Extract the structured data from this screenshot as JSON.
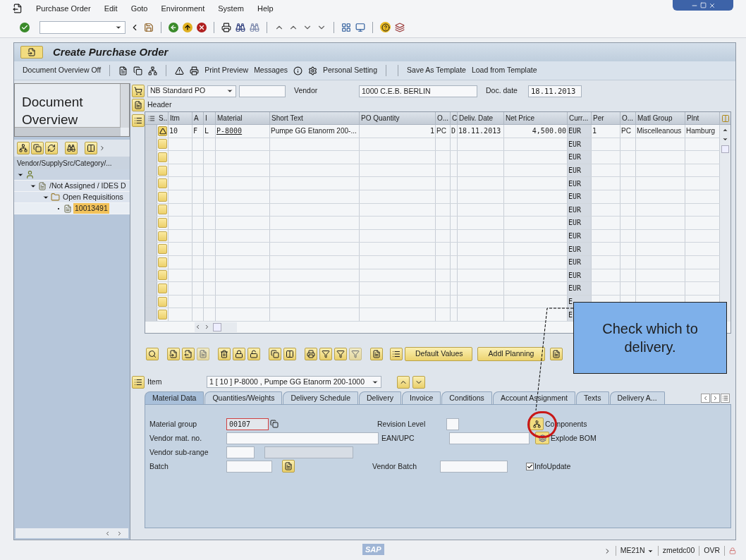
{
  "menu": [
    {
      "label": "Purchase Order"
    },
    {
      "label": "Edit"
    },
    {
      "label": "Goto"
    },
    {
      "label": "Environment"
    },
    {
      "label": "System"
    },
    {
      "label": "Help"
    }
  ],
  "title": "Create Purchase Order",
  "app_toolbar": [
    {
      "label": "Document Overview Off"
    },
    {
      "label": "Print Preview"
    },
    {
      "label": "Messages"
    },
    {
      "label": "Personal Setting"
    },
    {
      "label": "Save As Template"
    },
    {
      "label": "Load from Template"
    }
  ],
  "left_panel": {
    "overview_title": "Document Overview",
    "column_header": "Vendor/SupplySrc/Category/...",
    "tree": [
      {
        "kind": "vendor",
        "expanded": true,
        "selected": false,
        "children": [
          {
            "kind": "document",
            "label": "/Not Assigned / IDES D",
            "expanded": true,
            "selected": false,
            "children": [
              {
                "kind": "folder",
                "label": "Open Requisitions",
                "expanded": true,
                "selected": false,
                "children": [
                  {
                    "kind": "document",
                    "label": "10013491",
                    "selected": true
                  }
                ]
              }
            ]
          }
        ]
      }
    ]
  },
  "header_bar": {
    "doc_type": "NB Standard PO",
    "vendor_label": "Vendor",
    "vendor": "1000 C.E.B. BERLIN",
    "doc_date_label": "Doc. date",
    "doc_date": "18.11.2013",
    "header_label": "Header"
  },
  "items_table": {
    "columns": [
      "S..",
      "Itm",
      "A",
      "I",
      "Material",
      "Short Text",
      "PO Quantity",
      "O...",
      "C",
      "Deliv. Date",
      "Net Price",
      "Curr...",
      "Per",
      "O...",
      "Matl Group",
      "Plnt"
    ],
    "rows": [
      {
        "warning": true,
        "item": "10",
        "a": "F",
        "i": "L",
        "material": "P-8000",
        "short_text": "Pumpe GG Etanorm 200-...",
        "quantity": "1",
        "unit": "PC",
        "c": "D",
        "delivery_date": "18.11.2013",
        "net_price": "4,500.00",
        "currency": "EUR",
        "per": "1",
        "order_unit": "PC",
        "matl_group": "Miscelleanous",
        "plant": "Hamburg"
      },
      {
        "warning": false,
        "currency": "EUR"
      },
      {
        "warning": false,
        "currency": "EUR"
      },
      {
        "warning": false,
        "currency": "EUR"
      },
      {
        "warning": false,
        "currency": "EUR"
      },
      {
        "warning": false,
        "currency": "EUR"
      },
      {
        "warning": false,
        "currency": "EUR"
      },
      {
        "warning": false,
        "currency": "EUR"
      },
      {
        "warning": false,
        "currency": "EUR"
      },
      {
        "warning": false,
        "currency": "EUR"
      },
      {
        "warning": false,
        "currency": "EUR"
      },
      {
        "warning": false,
        "currency": "EUR"
      },
      {
        "warning": false,
        "currency": "EUR"
      },
      {
        "warning": false,
        "currency": "E"
      },
      {
        "warning": false,
        "currency": "E"
      }
    ]
  },
  "buttons": [
    {
      "label": "Default Values"
    },
    {
      "label": "Addl Planning"
    }
  ],
  "item_selector": {
    "label": "Item",
    "value": "1 [ 10 ] P-8000 , Pumpe GG Etanorm 200-1000"
  },
  "tabs": [
    {
      "label": "Material Data",
      "selected": true
    },
    {
      "label": "Quantities/Weights",
      "selected": false
    },
    {
      "label": "Delivery Schedule",
      "selected": false
    },
    {
      "label": "Delivery",
      "selected": false
    },
    {
      "label": "Invoice",
      "selected": false
    },
    {
      "label": "Conditions",
      "selected": false
    },
    {
      "label": "Account Assignment",
      "selected": false
    },
    {
      "label": "Texts",
      "selected": false
    },
    {
      "label": "Delivery A...",
      "selected": false
    }
  ],
  "material_data": {
    "material_group": {
      "label": "Material group",
      "value": "00107"
    },
    "vendor_mat_no": {
      "label": "Vendor mat. no."
    },
    "vendor_sub_range": {
      "label": "Vendor sub-range"
    },
    "batch": {
      "label": "Batch"
    },
    "revision_level": {
      "label": "Revision Level"
    },
    "ean_upc": {
      "label": "EAN/UPC"
    },
    "vendor_batch": {
      "label": "Vendor Batch"
    },
    "components_button": "Components",
    "explode_bom_button": "Explode BOM",
    "info_update": {
      "label": "InfoUpdate",
      "checked": true
    }
  },
  "callout": "Check which to delivery.",
  "status_bar": {
    "logo": "SAP",
    "transaction": "ME21N",
    "server": "zmetdc00",
    "mode": "OVR"
  }
}
